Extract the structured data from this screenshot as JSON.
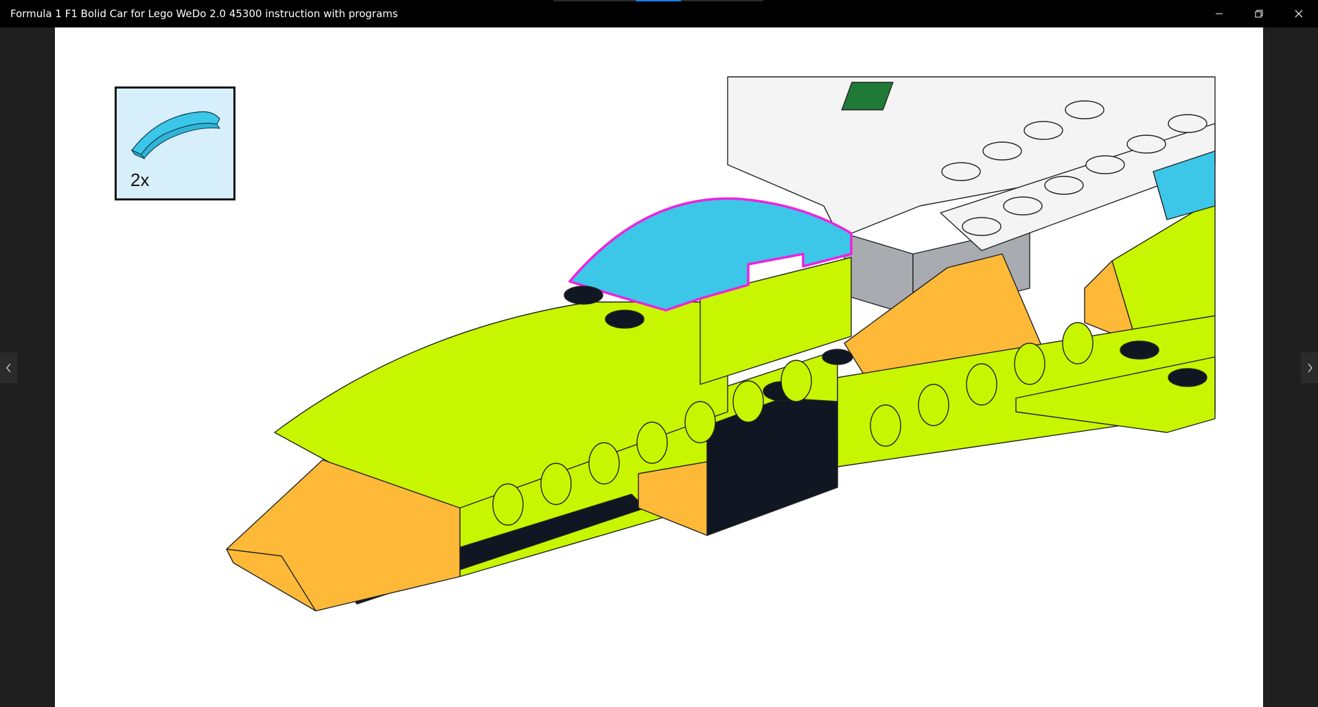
{
  "window": {
    "title": "Formula 1 F1 Bolid Car for Lego WeDo 2.0 45300 instruction with programs",
    "minimize_icon": "minimize-icon",
    "restore_icon": "restore-icon",
    "close_icon": "close-icon"
  },
  "viewer": {
    "progress": 0.4,
    "prev_icon": "chevron-left-icon",
    "next_icon": "chevron-right-icon"
  },
  "step": {
    "part_quantity": "2x",
    "part_icon": "curved-slope-brick-icon",
    "part_color": "#3cc6e8",
    "highlight_color": "#ee22dd"
  },
  "colors": {
    "lime": "#c8f500",
    "orange": "#ffb938",
    "azure": "#3cc6e8",
    "black": "#101622",
    "white": "#f4f4f4",
    "grey": "#a8acb0"
  }
}
